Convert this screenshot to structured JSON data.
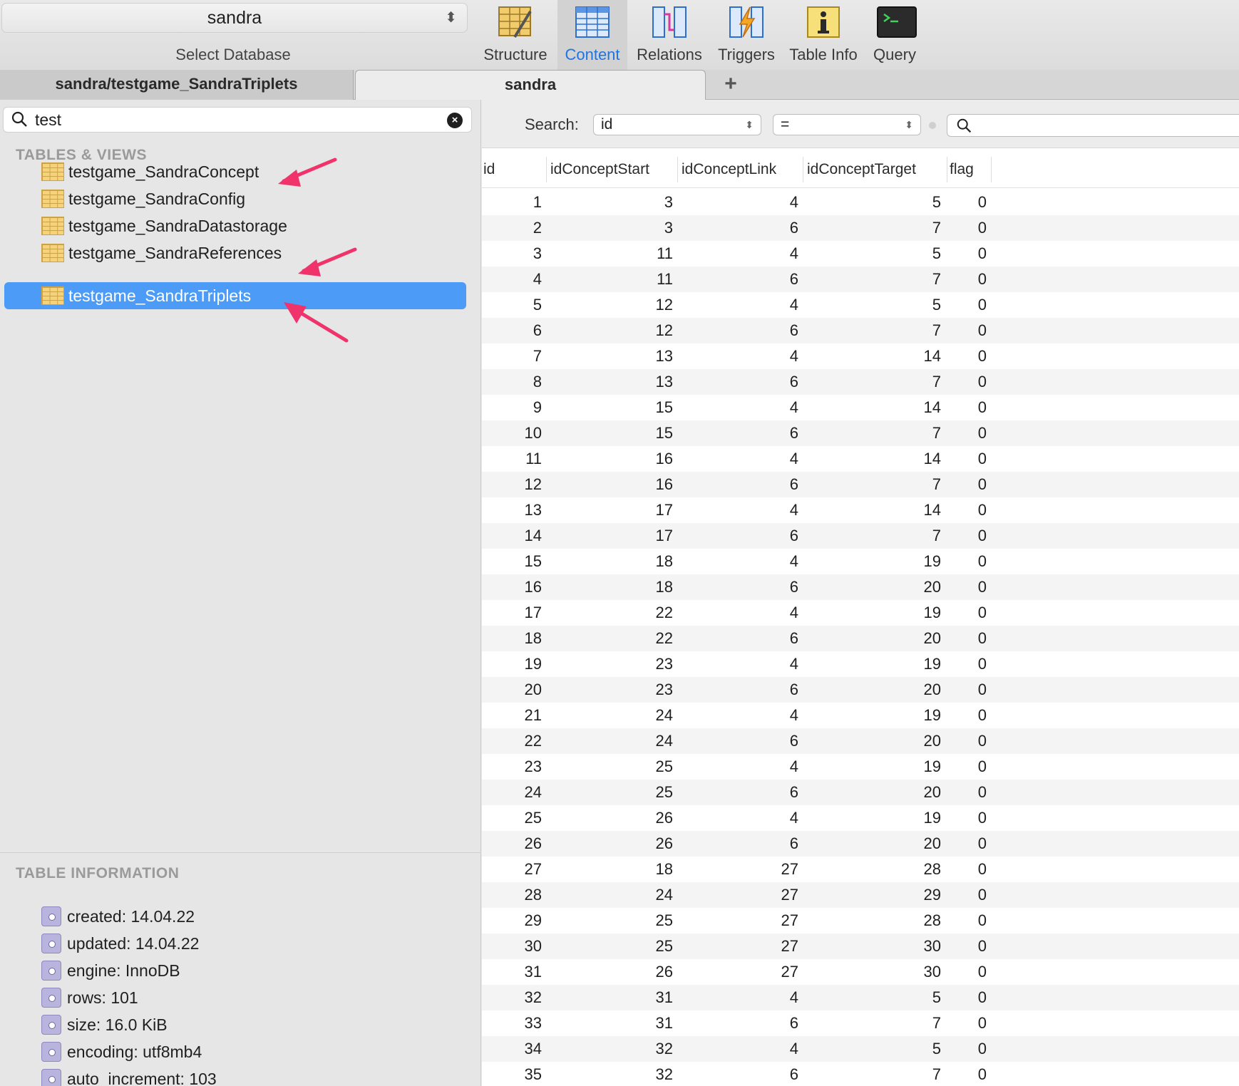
{
  "toolbar": {
    "database": "sandra",
    "database_caption": "Select Database",
    "tools": [
      {
        "label": "Structure",
        "icon": "structure-icon",
        "active": false
      },
      {
        "label": "Content",
        "icon": "content-icon",
        "active": true
      },
      {
        "label": "Relations",
        "icon": "relations-icon",
        "active": false
      },
      {
        "label": "Triggers",
        "icon": "triggers-icon",
        "active": false
      },
      {
        "label": "Table Info",
        "icon": "table-info-icon",
        "active": false
      },
      {
        "label": "Query",
        "icon": "query-icon",
        "active": false
      }
    ]
  },
  "tabs": [
    {
      "label": "sandra/testgame_SandraTriplets"
    },
    {
      "label": "sandra"
    }
  ],
  "tab_add_label": "+",
  "sidebar": {
    "filter_value": "test",
    "tables_heading": "TABLES & VIEWS",
    "tables": [
      {
        "name": "testgame_SandraConcept",
        "selected": false
      },
      {
        "name": "testgame_SandraConfig",
        "selected": false
      },
      {
        "name": "testgame_SandraDatastorage",
        "selected": false
      },
      {
        "name": "testgame_SandraReferences",
        "selected": false
      },
      {
        "name": "testgame_SandraTriplets",
        "selected": true
      }
    ],
    "info_heading": "TABLE INFORMATION",
    "info": [
      "created: 14.04.22",
      "updated: 14.04.22",
      "engine: InnoDB",
      "rows: 101",
      "size: 16.0 KiB",
      "encoding: utf8mb4",
      "auto_increment: 103"
    ]
  },
  "search": {
    "label": "Search:",
    "field": "id",
    "operator": "=",
    "value": ""
  },
  "table": {
    "columns": [
      "id",
      "idConceptStart",
      "idConceptLink",
      "idConceptTarget",
      "flag"
    ],
    "rows": [
      [
        1,
        3,
        4,
        5,
        0
      ],
      [
        2,
        3,
        6,
        7,
        0
      ],
      [
        3,
        11,
        4,
        5,
        0
      ],
      [
        4,
        11,
        6,
        7,
        0
      ],
      [
        5,
        12,
        4,
        5,
        0
      ],
      [
        6,
        12,
        6,
        7,
        0
      ],
      [
        7,
        13,
        4,
        14,
        0
      ],
      [
        8,
        13,
        6,
        7,
        0
      ],
      [
        9,
        15,
        4,
        14,
        0
      ],
      [
        10,
        15,
        6,
        7,
        0
      ],
      [
        11,
        16,
        4,
        14,
        0
      ],
      [
        12,
        16,
        6,
        7,
        0
      ],
      [
        13,
        17,
        4,
        14,
        0
      ],
      [
        14,
        17,
        6,
        7,
        0
      ],
      [
        15,
        18,
        4,
        19,
        0
      ],
      [
        16,
        18,
        6,
        20,
        0
      ],
      [
        17,
        22,
        4,
        19,
        0
      ],
      [
        18,
        22,
        6,
        20,
        0
      ],
      [
        19,
        23,
        4,
        19,
        0
      ],
      [
        20,
        23,
        6,
        20,
        0
      ],
      [
        21,
        24,
        4,
        19,
        0
      ],
      [
        22,
        24,
        6,
        20,
        0
      ],
      [
        23,
        25,
        4,
        19,
        0
      ],
      [
        24,
        25,
        6,
        20,
        0
      ],
      [
        25,
        26,
        4,
        19,
        0
      ],
      [
        26,
        26,
        6,
        20,
        0
      ],
      [
        27,
        18,
        27,
        28,
        0
      ],
      [
        28,
        24,
        27,
        29,
        0
      ],
      [
        29,
        25,
        27,
        28,
        0
      ],
      [
        30,
        25,
        27,
        30,
        0
      ],
      [
        31,
        26,
        27,
        30,
        0
      ],
      [
        32,
        31,
        4,
        5,
        0
      ],
      [
        33,
        31,
        6,
        7,
        0
      ],
      [
        34,
        32,
        4,
        5,
        0
      ],
      [
        35,
        32,
        6,
        7,
        0
      ]
    ]
  },
  "colors": {
    "accent": "#1e74e6",
    "selection": "#4b9bf7",
    "annotation_arrow": "#f0336b"
  }
}
